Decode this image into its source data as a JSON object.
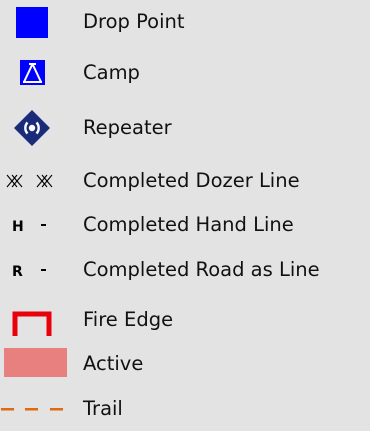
{
  "legend": {
    "items": [
      {
        "label": "Drop Point",
        "icon": "drop-point-square-icon",
        "color": "#0000ff"
      },
      {
        "label": "Camp",
        "icon": "camp-tent-icon",
        "color": "#0000ff"
      },
      {
        "label": "Repeater",
        "icon": "repeater-diamond-icon",
        "color": "#1a2b7a"
      },
      {
        "label": "Completed Dozer Line",
        "icon": "dozer-line-icon",
        "color": "#000000"
      },
      {
        "label": "Completed Hand Line",
        "icon": "hand-line-icon",
        "symbol_text": "H",
        "color": "#000000"
      },
      {
        "label": "Completed Road as Line",
        "icon": "road-line-icon",
        "symbol_text": "R",
        "color": "#000000"
      },
      {
        "label": "Fire Edge",
        "icon": "fire-edge-icon",
        "color": "#e8000b"
      },
      {
        "label": "Active",
        "icon": "active-fill-icon",
        "color": "#e88080"
      },
      {
        "label": "Trail",
        "icon": "trail-dashed-icon",
        "color": "#e06a10"
      }
    ]
  }
}
